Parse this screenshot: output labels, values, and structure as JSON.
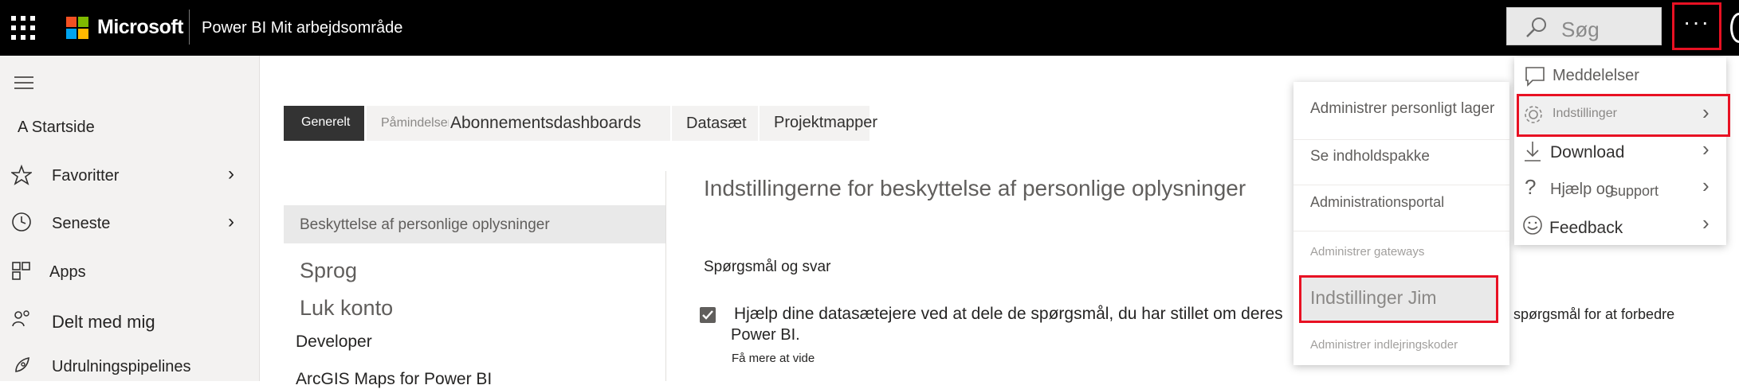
{
  "header": {
    "brand": "Microsoft",
    "title": "Power BI Mit arbejdsområde",
    "search_placeholder": "Søg",
    "more_label": "···"
  },
  "nav": {
    "home": "A Startside",
    "items": [
      {
        "label": "Favoritter",
        "icon": "star-icon",
        "chevron": true
      },
      {
        "label": "Seneste",
        "icon": "clock-icon",
        "chevron": true
      },
      {
        "label": "Apps",
        "icon": "apps-icon",
        "chevron": false
      },
      {
        "label": "Delt med mig",
        "icon": "shared-icon",
        "chevron": false
      },
      {
        "label": "Udrulningspipelines",
        "icon": "rocket-icon",
        "chevron": false
      }
    ]
  },
  "tabs": {
    "general": "Generelt",
    "reminders": "Påmindelser",
    "subscriptions": "Abonnementsdashboards",
    "datasets": "Datasæt",
    "workbooks": "Projektmapper"
  },
  "settings_nav": {
    "items": [
      "Beskyttelse af personlige oplysninger",
      "Sprog",
      "Luk konto",
      "Developer",
      "ArcGIS Maps for Power BI"
    ]
  },
  "content": {
    "heading": "Indstillingerne for beskyttelse af personlige oplysninger",
    "section": "Spørgsmål og svar",
    "checkbox_text": "Hjælp dine datasætejere ved at dele de spørgsmål, du har stillet om deres",
    "checkbox_text_tail": "spørgsmål for at forbedre",
    "checkbox_text_line2": "Power BI.",
    "learn_more": "Få mere at vide"
  },
  "dropdown": {
    "notifications": "Meddelelser",
    "settings": "Indstillinger",
    "download": "Download",
    "help_a": "Hjælp og",
    "help_b": "support",
    "feedback": "Feedback"
  },
  "submenu": {
    "items": [
      "Administrer personligt lager",
      "Se indholdspakke",
      "Administrationsportal",
      "Administrer gateways",
      "Indstillinger Jim",
      "Administrer indlejringskoder"
    ]
  },
  "colors": {
    "topbar": "#000000",
    "highlight": "#e81123",
    "selected_tab": "#333333",
    "checkbox": "#605e5c"
  }
}
